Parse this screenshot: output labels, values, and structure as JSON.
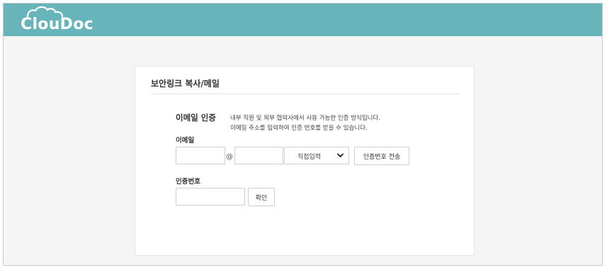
{
  "header": {
    "logo_text": "ClouDoc",
    "bg_color": "#67b4bb"
  },
  "card": {
    "title": "보안링크 복사/메일",
    "section_title": "이메일 인증",
    "description": [
      "내부 직원 및 외부 협력사에서 사용 가능한 인증 방식입니다.",
      "이메일 주소를 입력하여 인증 번호를 받을 수 있습니다."
    ],
    "email_label": "이메일",
    "email_local": {
      "value": "",
      "placeholder": ""
    },
    "at_symbol": "@",
    "email_domain": {
      "value": "",
      "placeholder": ""
    },
    "domain_select": {
      "selected": "직접입력"
    },
    "send_button": "인증번호 전송",
    "code_label": "인증번호",
    "code_input": {
      "value": "",
      "placeholder": ""
    },
    "confirm_button": "확인"
  }
}
